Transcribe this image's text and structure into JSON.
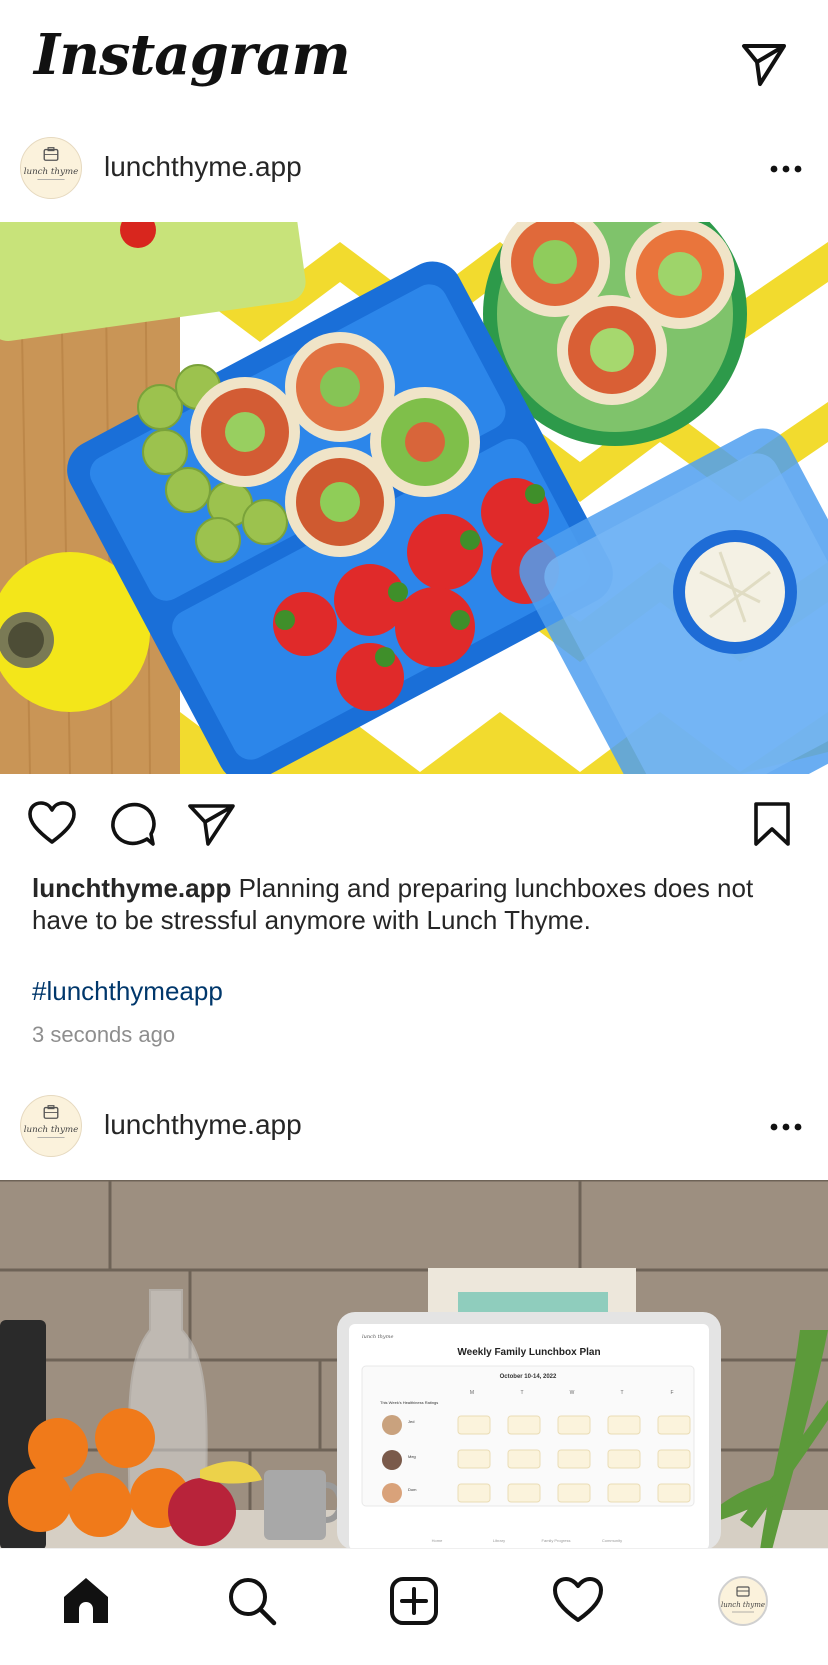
{
  "app": {
    "logo_text": "Instagram",
    "direct_icon": "paper-plane-icon"
  },
  "posts": [
    {
      "username": "lunchthyme.app",
      "avatar_text": "lunch thyme",
      "image": "lunchbox-photo",
      "caption_user": "lunchthyme.app",
      "caption_text": " Planning and preparing lunchboxes does not have to be stressful anymore with Lunch Thyme.",
      "hashtag": "#lunchthymeapp",
      "timestamp": "3 seconds ago"
    },
    {
      "username": "lunchthyme.app",
      "avatar_text": "lunch thyme",
      "image": "kitchen-tablet-photo",
      "tablet": {
        "title": "Weekly Family Lunchbox Plan",
        "week": "October 10-14, 2022",
        "ratings_label": "This Week's Healthiness Ratings",
        "days": [
          "M",
          "T",
          "W",
          "T",
          "F"
        ],
        "people": [
          "Jed",
          "Meg",
          "Dom"
        ],
        "nav": [
          "Home",
          "Library",
          "Family Progress",
          "Community"
        ]
      }
    }
  ],
  "tabbar": {
    "items": [
      "home-icon",
      "search-icon",
      "new-post-icon",
      "activity-heart-icon",
      "profile-avatar"
    ]
  },
  "colors": {
    "hashtag": "#00376b",
    "muted": "#8e8e8e",
    "text": "#262626"
  }
}
